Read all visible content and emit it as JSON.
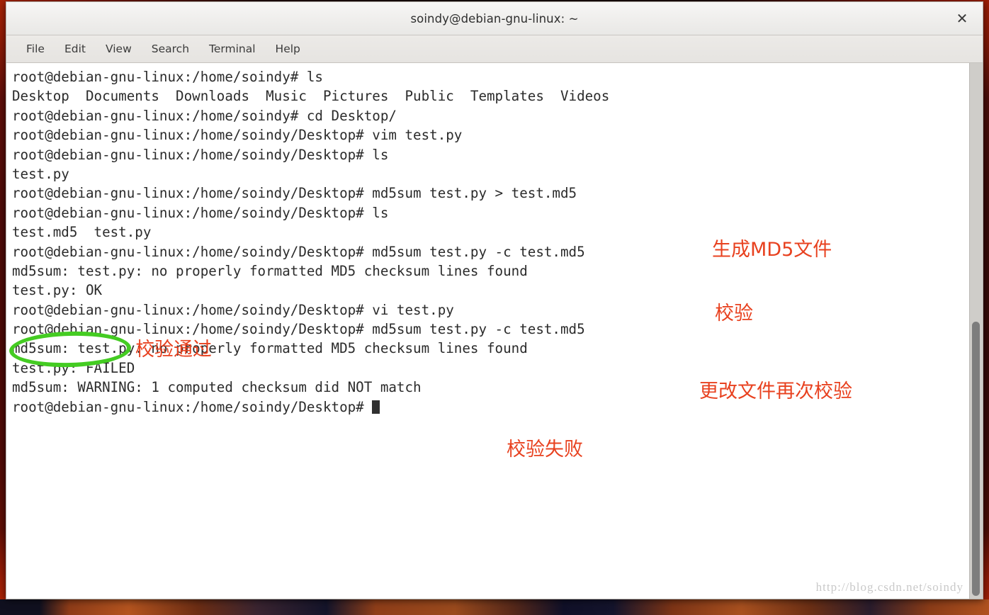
{
  "window": {
    "title": "soindy@debian-gnu-linux: ~",
    "close_label": "✕"
  },
  "menubar": {
    "items": [
      {
        "label": "File"
      },
      {
        "label": "Edit"
      },
      {
        "label": "View"
      },
      {
        "label": "Search"
      },
      {
        "label": "Terminal"
      },
      {
        "label": "Help"
      }
    ]
  },
  "terminal": {
    "lines": [
      "root@debian-gnu-linux:/home/soindy# ls",
      "Desktop  Documents  Downloads  Music  Pictures  Public  Templates  Videos",
      "root@debian-gnu-linux:/home/soindy# cd Desktop/",
      "root@debian-gnu-linux:/home/soindy/Desktop# vim test.py",
      "root@debian-gnu-linux:/home/soindy/Desktop# ls",
      "test.py",
      "root@debian-gnu-linux:/home/soindy/Desktop# md5sum test.py > test.md5",
      "root@debian-gnu-linux:/home/soindy/Desktop# ls",
      "test.md5  test.py",
      "root@debian-gnu-linux:/home/soindy/Desktop# md5sum test.py -c test.md5",
      "md5sum: test.py: no properly formatted MD5 checksum lines found",
      "test.py: OK",
      "root@debian-gnu-linux:/home/soindy/Desktop# vi test.py",
      "root@debian-gnu-linux:/home/soindy/Desktop# md5sum test.py -c test.md5",
      "md5sum: test.py: no properly formatted MD5 checksum lines found",
      "test.py: FAILED",
      "md5sum: WARNING: 1 computed checksum did NOT match"
    ],
    "prompt_last": "root@debian-gnu-linux:/home/soindy/Desktop# "
  },
  "annotations": {
    "color": "#e8411f",
    "highlight_color": "#44cc22",
    "generate_md5": "生成MD5文件",
    "verify": "校验",
    "verify_pass": "校验通过",
    "reverify_after_change": "更改文件再次校验",
    "verify_fail": "校验失败"
  },
  "watermark": {
    "text": "http://blog.csdn.net/soindy"
  }
}
